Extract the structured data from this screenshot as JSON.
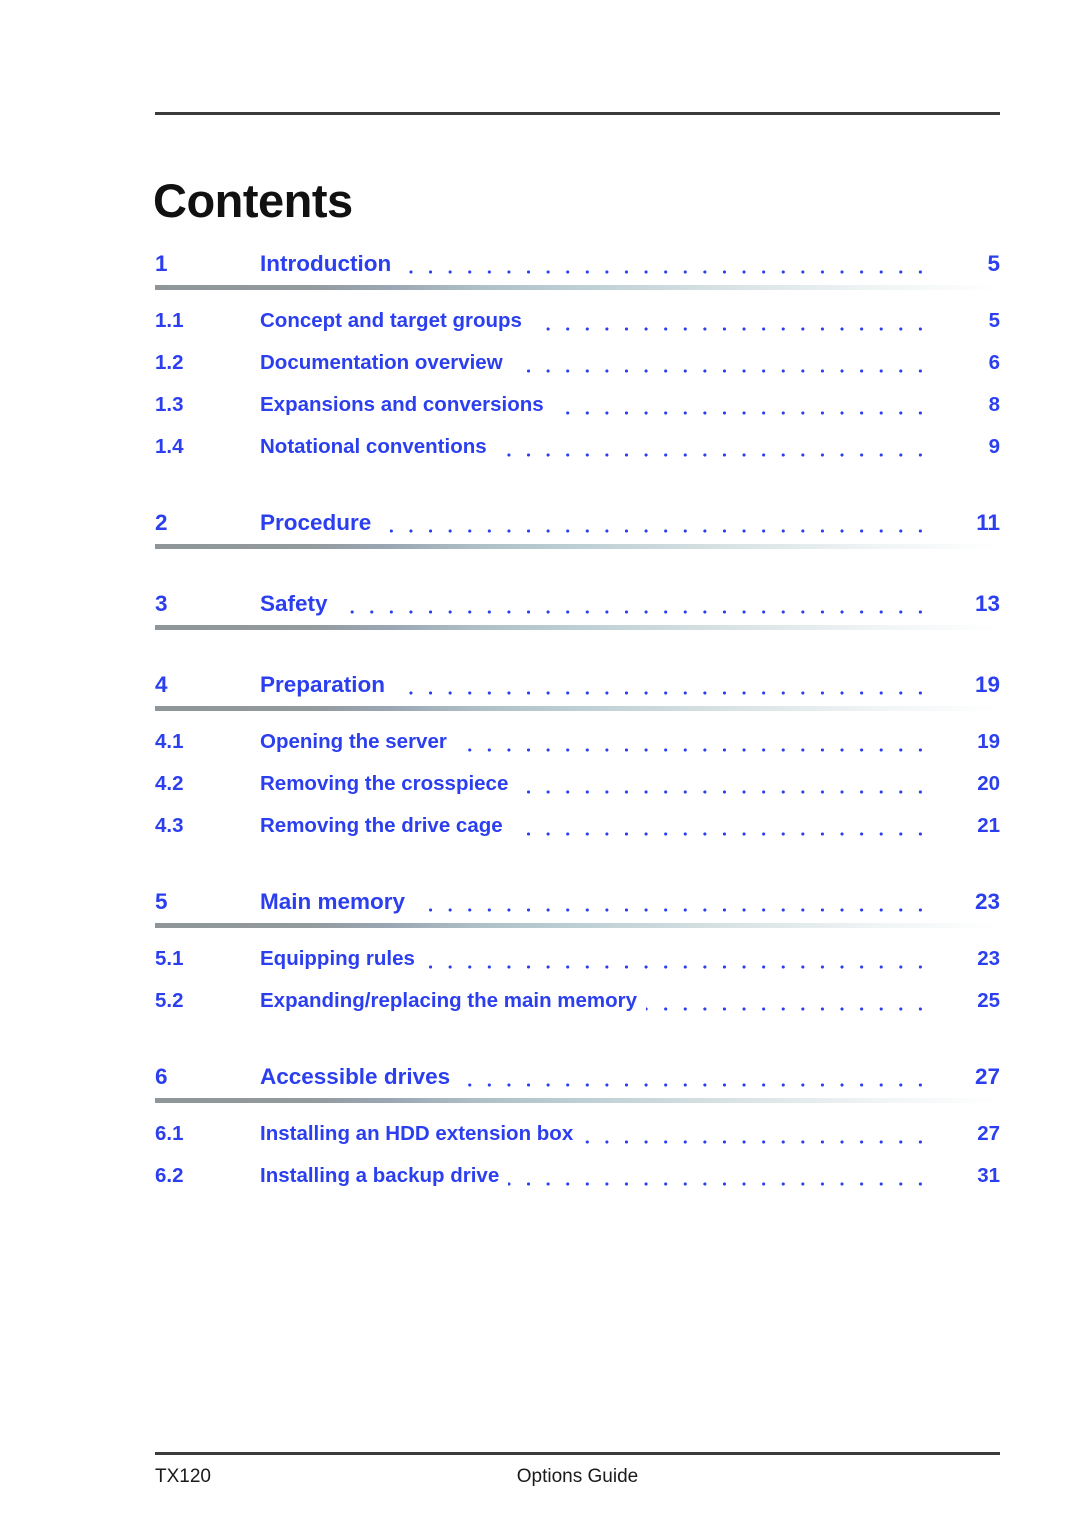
{
  "document": {
    "title": "Contents",
    "accent_color": "#2c3fee",
    "heading_color": "#111111",
    "rule_color": "#3b3b3d"
  },
  "toc": {
    "entries": [
      {
        "number": "1",
        "title": "Introduction",
        "page": "5",
        "level": 1,
        "rule_after": true
      },
      {
        "number": "1.1",
        "title": "Concept and target groups",
        "page": "5",
        "level": 2,
        "rule_after": false
      },
      {
        "number": "1.2",
        "title": "Documentation overview",
        "page": "6",
        "level": 2,
        "rule_after": false
      },
      {
        "number": "1.3",
        "title": "Expansions and conversions",
        "page": "8",
        "level": 2,
        "rule_after": false
      },
      {
        "number": "1.4",
        "title": "Notational conventions",
        "page": "9",
        "level": 2,
        "rule_after": false
      },
      {
        "number": "2",
        "title": "Procedure",
        "page": "11",
        "level": 1,
        "rule_after": true
      },
      {
        "number": "3",
        "title": "Safety",
        "page": "13",
        "level": 1,
        "rule_after": true
      },
      {
        "number": "4",
        "title": "Preparation",
        "page": "19",
        "level": 1,
        "rule_after": true
      },
      {
        "number": "4.1",
        "title": "Opening the server",
        "page": "19",
        "level": 2,
        "rule_after": false
      },
      {
        "number": "4.2",
        "title": "Removing the crosspiece",
        "page": "20",
        "level": 2,
        "rule_after": false
      },
      {
        "number": "4.3",
        "title": "Removing the drive cage",
        "page": "21",
        "level": 2,
        "rule_after": false
      },
      {
        "number": "5",
        "title": "Main memory",
        "page": "23",
        "level": 1,
        "rule_after": true
      },
      {
        "number": "5.1",
        "title": "Equipping rules",
        "page": "23",
        "level": 2,
        "rule_after": false
      },
      {
        "number": "5.2",
        "title": "Expanding/replacing the main memory",
        "page": "25",
        "level": 2,
        "rule_after": false
      },
      {
        "number": "6",
        "title": "Accessible drives",
        "page": "27",
        "level": 1,
        "rule_after": true
      },
      {
        "number": "6.1",
        "title": "Installing an HDD extension box",
        "page": "27",
        "level": 2,
        "rule_after": false
      },
      {
        "number": "6.2",
        "title": "Installing a backup drive",
        "page": "31",
        "level": 2,
        "rule_after": false
      }
    ]
  },
  "footer": {
    "left": "TX120",
    "center": "Options Guide"
  }
}
